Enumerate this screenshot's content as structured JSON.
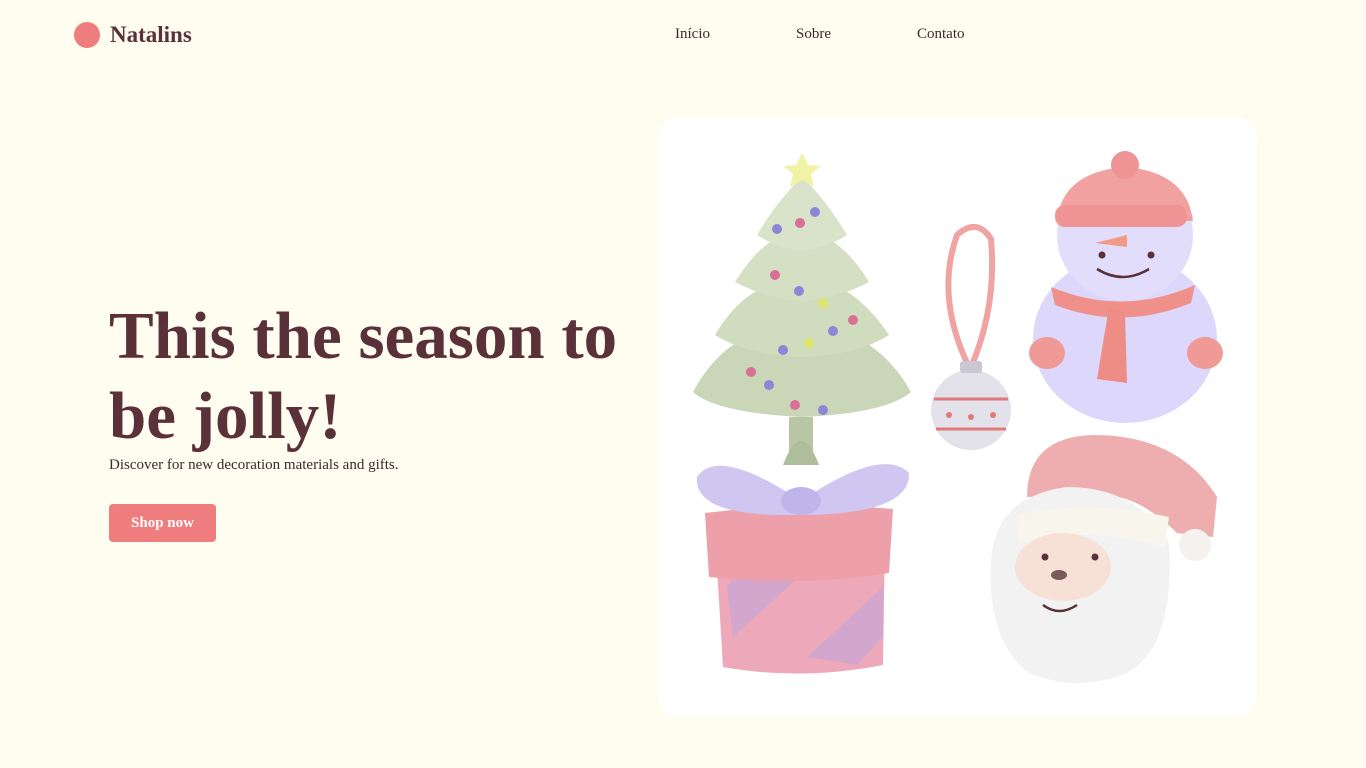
{
  "brand": {
    "name": "Natalins",
    "dot_color": "#ef7d7d"
  },
  "nav": {
    "items": [
      "Início",
      "Sobre",
      "Contato"
    ]
  },
  "hero": {
    "title": "This the season to be jolly!",
    "subtitle": "Discover for new decoration materials and gifts.",
    "cta": "Shop now"
  },
  "illustration": {
    "items": [
      "christmas-tree-icon",
      "ornament-icon",
      "snowman-icon",
      "gift-box-icon",
      "santa-icon"
    ]
  },
  "colors": {
    "background": "#fffcf0",
    "accent": "#ef7d7d",
    "text": "#5a3039",
    "card": "#ffffff"
  }
}
